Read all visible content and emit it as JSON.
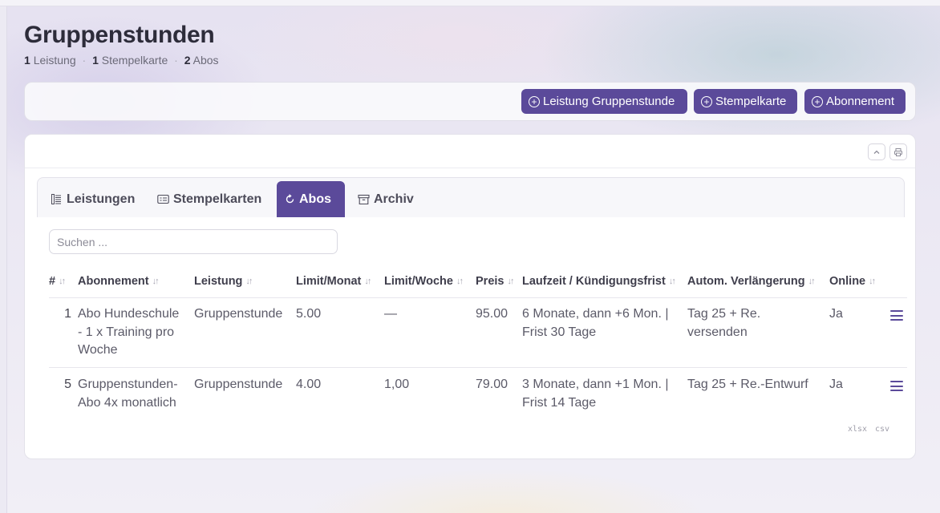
{
  "page": {
    "title": "Gruppenstunden",
    "summary": [
      {
        "count": "1",
        "label": "Leistung"
      },
      {
        "count": "1",
        "label": "Stempelkarte"
      },
      {
        "count": "2",
        "label": "Abos"
      }
    ],
    "separator": "·"
  },
  "actions": [
    {
      "label": "Leistung Gruppenstunde",
      "icon": "plus-circle-icon"
    },
    {
      "label": "Stempelkarte",
      "icon": "plus-circle-icon"
    },
    {
      "label": "Abonnement",
      "icon": "plus-circle-icon"
    }
  ],
  "tabs": [
    {
      "label": "Leistungen",
      "icon": "list-icon",
      "active": false
    },
    {
      "label": "Stempelkarten",
      "icon": "card-icon",
      "active": false
    },
    {
      "label": "Abos",
      "icon": "refresh-icon",
      "active": true
    },
    {
      "label": "Archiv",
      "icon": "archive-icon",
      "active": false
    }
  ],
  "search": {
    "placeholder": "Suchen ...",
    "value": ""
  },
  "table": {
    "sort_glyph": "↓↑",
    "columns": [
      "#",
      "Abonnement",
      "Leistung",
      "Limit/Monat",
      "Limit/Woche",
      "Preis",
      "Laufzeit / Kündigungsfrist",
      "Autom. Verlängerung",
      "Online"
    ],
    "rows": [
      {
        "id": "1",
        "abonnement": [
          "Abo Hundeschule",
          "- 1 x Training pro",
          "Woche"
        ],
        "leistung": "Gruppenstunde",
        "limit_monat": "5.00",
        "limit_woche": "—",
        "preis": "95.00",
        "laufzeit": [
          "6 Monate, dann +6 Mon. |",
          "Frist 30 Tage"
        ],
        "verlaengerung": [
          "Tag 25 + Re.",
          "versenden"
        ],
        "online": "Ja"
      },
      {
        "id": "5",
        "abonnement": [
          "Gruppenstunden-",
          "Abo 4x monatlich"
        ],
        "leistung": "Gruppenstunde",
        "limit_monat": "4.00",
        "limit_woche": "1,00",
        "preis": "79.00",
        "laufzeit": [
          "3 Monate, dann +1 Mon. |",
          "Frist 14 Tage"
        ],
        "verlaengerung": [
          "Tag 25 + Re.-Entwurf"
        ],
        "online": "Ja"
      }
    ]
  },
  "exports": [
    "xlsx",
    "csv"
  ],
  "colors": {
    "accent": "#5b4a9a",
    "text": "#2d2c3a",
    "muted": "#6b6a78"
  }
}
